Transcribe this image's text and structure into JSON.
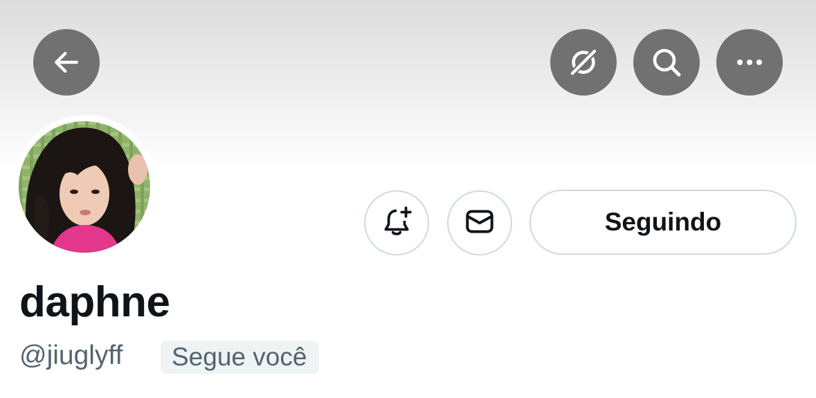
{
  "header": {
    "back_icon": "arrow-left-icon",
    "grok_icon": "grok-icon",
    "search_icon": "search-icon",
    "more_icon": "more-horizontal-icon",
    "button_color": "#717171"
  },
  "profile": {
    "display_name": "daphne",
    "handle": "@jiuglyff",
    "follows_you_label": "Segue você"
  },
  "actions": {
    "notify_icon": "bell-plus-icon",
    "message_icon": "envelope-icon",
    "following_label": "Seguindo"
  },
  "colors": {
    "text_primary": "#0f1419",
    "text_secondary": "#536471",
    "border": "#cfd9de",
    "badge_bg": "#eff3f4"
  }
}
